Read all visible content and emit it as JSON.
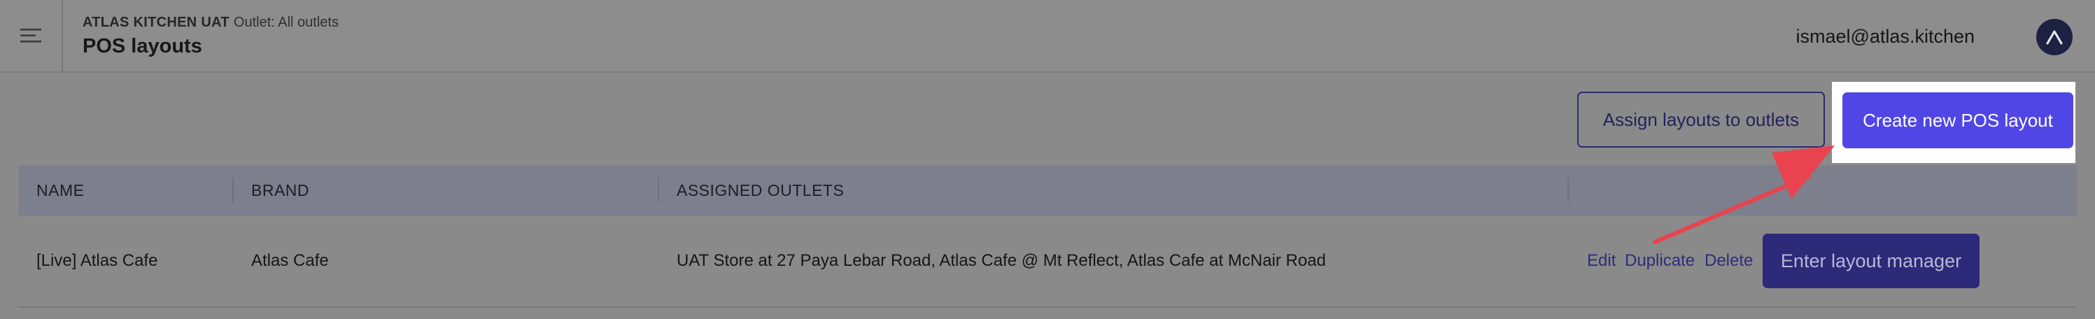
{
  "header": {
    "org_name": "ATLAS KITCHEN UAT",
    "outlet_label": "Outlet: All outlets",
    "page_title": "POS layouts",
    "user_email": "ismael@atlas.kitchen",
    "menu_icon": "hamburger-menu-icon",
    "avatar_icon": "atlas-logo-icon"
  },
  "actions": {
    "assign_label": "Assign layouts to outlets",
    "create_label": "Create new POS layout"
  },
  "table": {
    "columns": [
      "NAME",
      "BRAND",
      "ASSIGNED OUTLETS",
      ""
    ],
    "rows": [
      {
        "name": "[Live] Atlas Cafe",
        "brand": "Atlas Cafe",
        "assigned_outlets": "UAT Store at 27 Paya Lebar Road, Atlas Cafe @ Mt Reflect, Atlas Cafe at McNair Road",
        "actions": {
          "edit": "Edit",
          "duplicate": "Duplicate",
          "delete": "Delete",
          "enter_manager": "Enter layout manager"
        }
      }
    ]
  },
  "colors": {
    "primary": "#4f46e5",
    "overlay_gray": "#8a8a8a",
    "annotation_arrow": "#e8434f",
    "highlight": "#ffffff"
  }
}
